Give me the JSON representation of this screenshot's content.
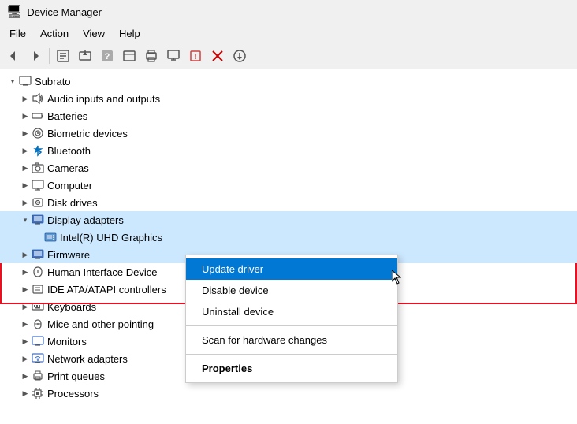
{
  "titleBar": {
    "title": "Device Manager",
    "iconUnicode": "🖥"
  },
  "menuBar": {
    "items": [
      {
        "label": "File"
      },
      {
        "label": "Action"
      },
      {
        "label": "View"
      },
      {
        "label": "Help"
      }
    ]
  },
  "toolbar": {
    "buttons": [
      {
        "name": "back",
        "icon": "◀"
      },
      {
        "name": "forward",
        "icon": "▶"
      },
      {
        "name": "properties",
        "icon": "📋"
      },
      {
        "name": "update-driver",
        "icon": "🔄"
      },
      {
        "name": "scan",
        "icon": "❓"
      },
      {
        "name": "view-list",
        "icon": "≡"
      },
      {
        "name": "print",
        "icon": "🖨"
      },
      {
        "name": "display",
        "icon": "🖥"
      },
      {
        "name": "unknown-device",
        "icon": "❔"
      },
      {
        "name": "remove",
        "icon": "✖"
      },
      {
        "name": "download",
        "icon": "⬇"
      }
    ]
  },
  "tree": {
    "rootItem": "Subrato",
    "items": [
      {
        "id": "audio",
        "label": "Audio inputs and outputs",
        "icon": "🔊",
        "indent": 2,
        "expanded": false
      },
      {
        "id": "batteries",
        "label": "Batteries",
        "icon": "🔋",
        "indent": 2,
        "expanded": false
      },
      {
        "id": "biometric",
        "label": "Biometric devices",
        "icon": "👁",
        "indent": 2,
        "expanded": false
      },
      {
        "id": "bluetooth",
        "label": "Bluetooth",
        "icon": "🔵",
        "indent": 2,
        "expanded": false
      },
      {
        "id": "cameras",
        "label": "Cameras",
        "icon": "📷",
        "indent": 2,
        "expanded": false
      },
      {
        "id": "computer",
        "label": "Computer",
        "icon": "💻",
        "indent": 2,
        "expanded": false
      },
      {
        "id": "disk",
        "label": "Disk drives",
        "icon": "💾",
        "indent": 2,
        "expanded": false
      },
      {
        "id": "display",
        "label": "Display adapters",
        "icon": "📺",
        "indent": 2,
        "expanded": true,
        "highlighted": true
      },
      {
        "id": "gpu",
        "label": "Intel(R) UHD Graphics",
        "icon": "📺",
        "indent": 3,
        "contextSelected": true
      },
      {
        "id": "firmware",
        "label": "Firmware",
        "icon": "📺",
        "indent": 2,
        "expanded": false,
        "highlighted": true
      },
      {
        "id": "hid",
        "label": "Human Interface Device",
        "icon": "🖱",
        "indent": 2,
        "expanded": false
      },
      {
        "id": "ide",
        "label": "IDE ATA/ATAPI controllers",
        "icon": "💾",
        "indent": 2,
        "expanded": false
      },
      {
        "id": "keyboards",
        "label": "Keyboards",
        "icon": "⌨",
        "indent": 2,
        "expanded": false
      },
      {
        "id": "mice",
        "label": "Mice and other pointing",
        "icon": "🖱",
        "indent": 2,
        "expanded": false
      },
      {
        "id": "monitors",
        "label": "Monitors",
        "icon": "🖥",
        "indent": 2,
        "expanded": false
      },
      {
        "id": "network",
        "label": "Network adapters",
        "icon": "🌐",
        "indent": 2,
        "expanded": false
      },
      {
        "id": "print",
        "label": "Print queues",
        "icon": "🖨",
        "indent": 2,
        "expanded": false
      },
      {
        "id": "processors",
        "label": "Processors",
        "icon": "⚙",
        "indent": 2,
        "expanded": false
      }
    ]
  },
  "contextMenu": {
    "items": [
      {
        "id": "update-driver",
        "label": "Update driver",
        "active": true
      },
      {
        "id": "disable-device",
        "label": "Disable device"
      },
      {
        "id": "uninstall-device",
        "label": "Uninstall device"
      },
      {
        "id": "scan-hardware",
        "label": "Scan for hardware changes"
      },
      {
        "id": "properties",
        "label": "Properties",
        "bold": true
      }
    ]
  }
}
